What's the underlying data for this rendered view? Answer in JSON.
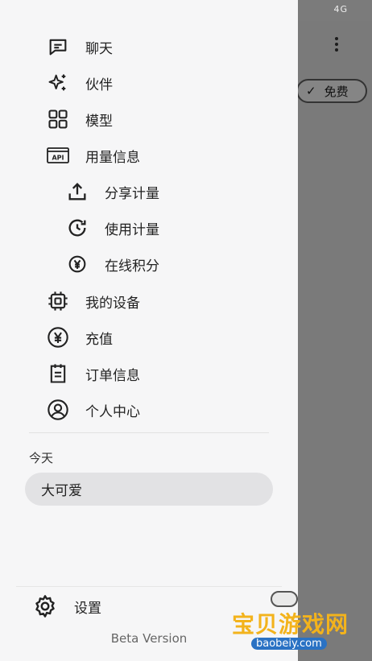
{
  "status_bar": {
    "network": "4G",
    "signal": "ᴵᴵᴵ"
  },
  "background": {
    "chip_label": "免费"
  },
  "menu": {
    "items": [
      {
        "label": "聊天",
        "icon": "chat-icon"
      },
      {
        "label": "伙伴",
        "icon": "sparkles-icon"
      },
      {
        "label": "模型",
        "icon": "grid-icon"
      },
      {
        "label": "用量信息",
        "icon": "api-icon",
        "icon_text": "API"
      },
      {
        "label": "分享计量",
        "icon": "share-upload-icon"
      },
      {
        "label": "使用计量",
        "icon": "history-clock-icon"
      },
      {
        "label": "在线积分",
        "icon": "yen-coin-icon"
      },
      {
        "label": "我的设备",
        "icon": "chip-icon"
      },
      {
        "label": "充值",
        "icon": "yen-circle-icon"
      },
      {
        "label": "订单信息",
        "icon": "order-list-icon"
      },
      {
        "label": "个人中心",
        "icon": "person-circle-icon"
      }
    ]
  },
  "history": {
    "section_label": "今天",
    "chats": [
      "大可爱"
    ]
  },
  "footer": {
    "settings_label": "设置",
    "version": "Beta Version"
  },
  "watermark": {
    "title": "宝贝游戏网",
    "url": "baobeiy.com"
  }
}
